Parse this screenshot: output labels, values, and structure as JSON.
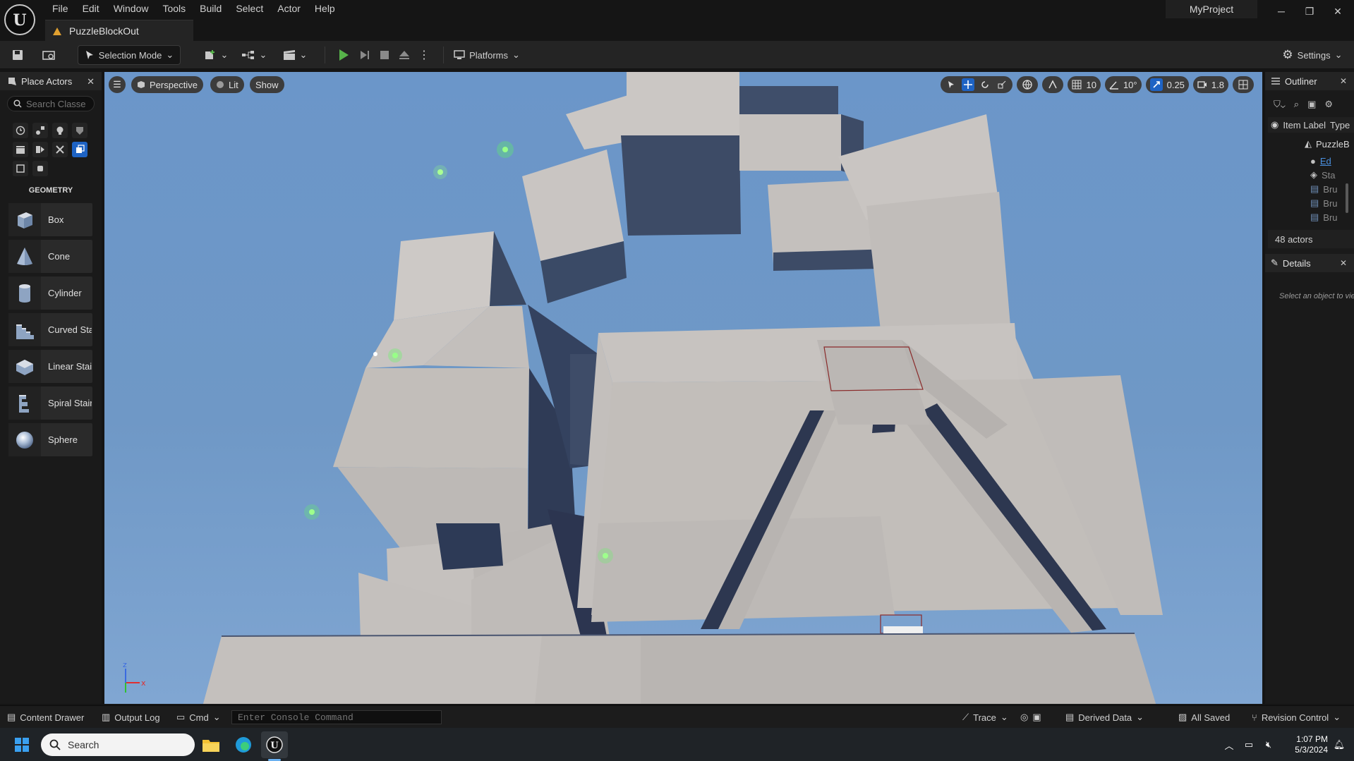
{
  "app": {
    "menu": [
      "File",
      "Edit",
      "Window",
      "Tools",
      "Build",
      "Select",
      "Actor",
      "Help"
    ],
    "level_tab": "PuzzleBlockOut",
    "project_name": "MyProject"
  },
  "toolbar": {
    "mode_label": "Selection Mode",
    "platforms_label": "Platforms",
    "settings_label": "Settings"
  },
  "place_actors": {
    "tab_label": "Place Actors",
    "search_placeholder": "Search Classes",
    "category_title": "GEOMETRY",
    "items": [
      {
        "label": "Box",
        "icon": "box-icon"
      },
      {
        "label": "Cone",
        "icon": "cone-icon"
      },
      {
        "label": "Cylinder",
        "icon": "cylinder-icon"
      },
      {
        "label": "Curved Stair",
        "icon": "curved-stair-icon"
      },
      {
        "label": "Linear Stair",
        "icon": "linear-stair-icon"
      },
      {
        "label": "Spiral Stair",
        "icon": "spiral-stair-icon"
      },
      {
        "label": "Sphere",
        "icon": "sphere-icon"
      }
    ]
  },
  "viewport": {
    "perspective_label": "Perspective",
    "lit_label": "Lit",
    "show_label": "Show",
    "grid_snap": "10",
    "rotation_snap": "10°",
    "scale_snap": "0.25",
    "camera_speed": "1.8"
  },
  "outliner": {
    "tab_label": "Outliner",
    "column_label": "Item Label",
    "column_type": "Type",
    "rows": [
      {
        "label": "PuzzleBlockOut",
        "type": ""
      },
      {
        "label": "",
        "type": "Ed"
      },
      {
        "label": "",
        "type": "Sta"
      },
      {
        "label": "",
        "type": "Bru"
      },
      {
        "label": "",
        "type": "Bru"
      },
      {
        "label": "",
        "type": "Bru"
      }
    ],
    "actor_count": "48 actors"
  },
  "details": {
    "tab_label": "Details",
    "empty_text": "Select an object to view details."
  },
  "statusbar": {
    "content_drawer": "Content Drawer",
    "output_log": "Output Log",
    "cmd": "Cmd",
    "console_placeholder": "Enter Console Command",
    "trace": "Trace",
    "derived_data": "Derived Data",
    "all_saved": "All Saved",
    "revision_control": "Revision Control"
  },
  "taskbar": {
    "search_placeholder": "Search",
    "time": "1:07 PM",
    "date": "5/3/2024"
  },
  "colors": {
    "accent": "#1e63c4",
    "sky": "#6f98c6",
    "geometry": "#b8b4b2",
    "play_green": "#57b34a"
  }
}
